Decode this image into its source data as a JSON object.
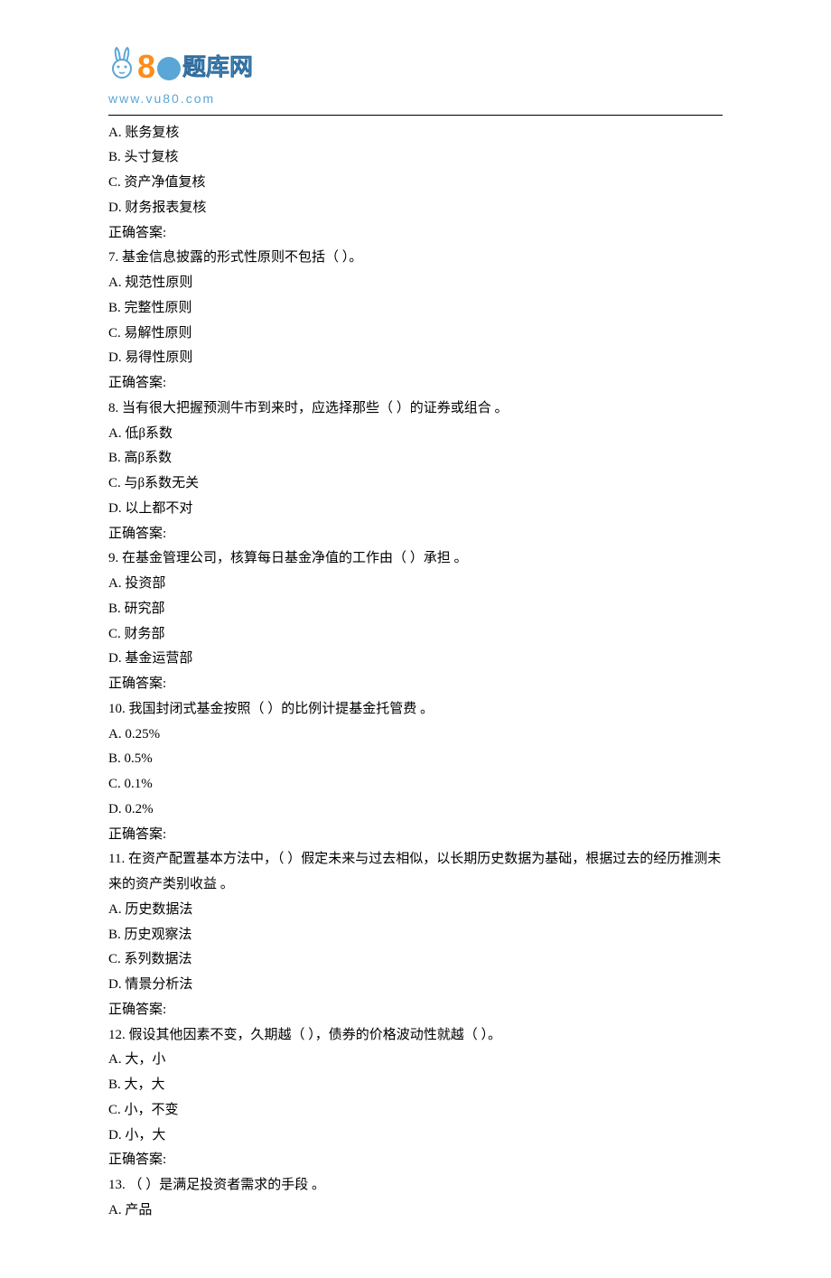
{
  "logo": {
    "eight": "8",
    "text": "题库网",
    "url": "www.vu80.com"
  },
  "preOptions": {
    "a": "A. 账务复核",
    "b": "B. 头寸复核",
    "c": "C. 资产净值复核",
    "d": "D. 财务报表复核",
    "answer": "正确答案:"
  },
  "questions": [
    {
      "num": "7.",
      "text": "  基金信息披露的形式性原则不包括（  ）。",
      "options": {
        "a": "A. 规范性原则",
        "b": "B. 完整性原则",
        "c": "C. 易解性原则",
        "d": "D. 易得性原则"
      },
      "answer": "正确答案:"
    },
    {
      "num": "8.",
      "text": "  当有很大把握预测牛市到来时，应选择那些（  ）的证券或组合 。",
      "options": {
        "a": "A. 低β系数",
        "b": "B. 高β系数",
        "c": "C. 与β系数无关",
        "d": "D. 以上都不对"
      },
      "answer": "正确答案:"
    },
    {
      "num": "9.",
      "text": "  在基金管理公司，核算每日基金净值的工作由（  ）承担 。",
      "options": {
        "a": "A. 投资部",
        "b": "B. 研究部",
        "c": "C. 财务部",
        "d": "D. 基金运营部"
      },
      "answer": "正确答案:"
    },
    {
      "num": "10.",
      "text": "  我国封闭式基金按照（  ）的比例计提基金托管费 。",
      "options": {
        "a": "A. 0.25%",
        "b": "B. 0.5%",
        "c": "C. 0.1%",
        "d": "D. 0.2%"
      },
      "answer": "正确答案:"
    },
    {
      "num": "11.",
      "text": "  在资产配置基本方法中，（  ）假定未来与过去相似，以长期历史数据为基础，根据过去的经历推测未来的资产类别收益 。",
      "options": {
        "a": "A. 历史数据法",
        "b": "B. 历史观察法",
        "c": "C. 系列数据法",
        "d": "D. 情景分析法"
      },
      "answer": "正确答案:"
    },
    {
      "num": "12.",
      "text": "  假设其他因素不变，久期越（  ），债券的价格波动性就越（  ）。",
      "options": {
        "a": "A. 大，小",
        "b": "B. 大，大",
        "c": "C. 小，不变",
        "d": "D. 小，大"
      },
      "answer": "正确答案:"
    },
    {
      "num": "13.",
      "text": "  （  ）是满足投资者需求的手段 。",
      "options": {
        "a": "A. 产品"
      },
      "answer": ""
    }
  ]
}
